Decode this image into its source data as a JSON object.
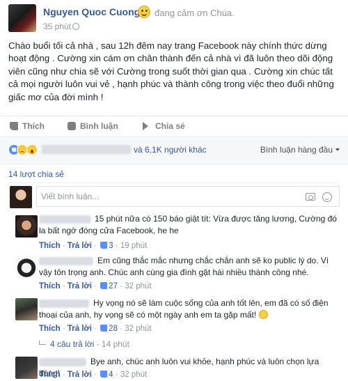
{
  "post": {
    "author": "Nguyen Quoc Cuong",
    "feeling": "đang cảm ơn Chúa.",
    "time": "35 phút",
    "text": "Chào buổi tối cả nhà , sau 12h đêm nay trang Facebook này chính thức dừng hoạt động . Cường xin cám ơn chân thành đến cả nhà vì đã luôn theo dõi động viên cũng như chia sẽ với Cường trong suốt thời gian qua . Cường xin chúc tất cả mọi người luôn vui vẻ , hạnh phúc và thành công trong việc theo đuổi những giấc mơ của đời mình !"
  },
  "actions": {
    "like": "Thích",
    "comment": "Bình luận",
    "share": "Chia sẻ"
  },
  "reactions": {
    "count_text": "và 6,1K người khác",
    "sort_label": "Bình luận hàng đầu",
    "types": [
      "like",
      "sad",
      "wow"
    ]
  },
  "shares": "14 lượt chia sẻ",
  "composer": {
    "placeholder": "Viết bình luận..."
  },
  "comments": [
    {
      "text": "15 phút nữa có 150 báo giật tít: Vừa được tăng lương, Cường đó la bất ngờ đóng cửa Facebook, he he",
      "like": "Thích",
      "reply": "Trả lời",
      "likes": "3",
      "time": "19 phút"
    },
    {
      "text": "Em cũng thắc mắc nhưng chắc chắn anh sẽ ko public lý do. Vì vậy tôn trọng anh. Chúc anh cùng gia đình gặt hái nhiều thành công nhé.",
      "like": "Thích",
      "reply": "Trả lời",
      "likes": "27",
      "time": "32 phút"
    },
    {
      "text": "Hy vọng nó sẽ làm cuộc sống của anh tốt lên, em đã có số điện thoại của anh, hy vọng sẽ có một ngày anh em ta gặp mất!",
      "like": "Thích",
      "reply": "Trả lời",
      "likes": "28",
      "time": "32 phút",
      "replies": "4 câu trả lời",
      "replies_time": "14 phút"
    },
    {
      "text": "Bye anh, chúc anh luôn vui khỏe, hạnh phúc và luôn chọn lựa đúng!",
      "like": "Thích",
      "reply": "Trả lời",
      "likes": "4",
      "time": "32 phút"
    }
  ],
  "colors": {
    "link": "#365899",
    "muted": "#90949c",
    "like_blue": "#5890ff"
  }
}
